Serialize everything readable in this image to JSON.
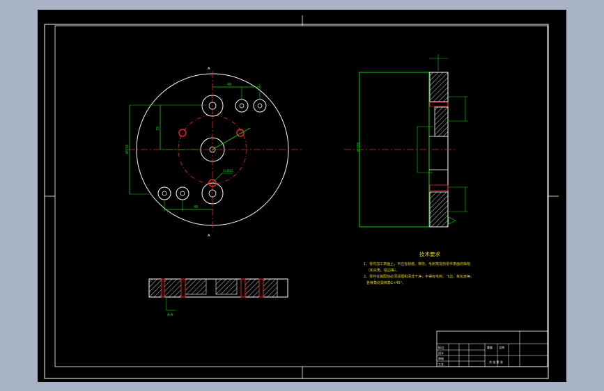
{
  "colors": {
    "background": "#000000",
    "frame": "#ffffff",
    "outline": "#ffffff",
    "centerline": "#ff2020",
    "dimension": "#00dd00",
    "hatch": "#ffffff",
    "title_text": "#ffffff",
    "notes_text": "#e8d800",
    "desktop": "#a9b3c6"
  },
  "tech_requirements": {
    "title": "技术要求",
    "line1": "1、零件加工表面上，不应有划痕、擦伤、毛刺等损伤零件表面的缺陷",
    "line2": "（如尖角、锐边等）。",
    "line3": "2、零件在装配前必须清理和清洗干净，不得有毛刺、飞边、氧化皮等。",
    "line4": "各棱角处需倒角1×45°。"
  },
  "title_block": {
    "mark": "标记",
    "design": "设计",
    "review": "审核",
    "process": "工艺",
    "scale": "比例",
    "weight": "重量",
    "sheet": "共 张 第 张"
  },
  "annotations": {
    "section_mark_a": "A",
    "section_mark_b": "A",
    "dim_top": "40",
    "dim_left": "Ø150",
    "dim_mid": "35",
    "dim_side": "Ø180",
    "dim_bottom": "40",
    "dim_hole": "3×Ø12",
    "section_note": "A-A"
  }
}
